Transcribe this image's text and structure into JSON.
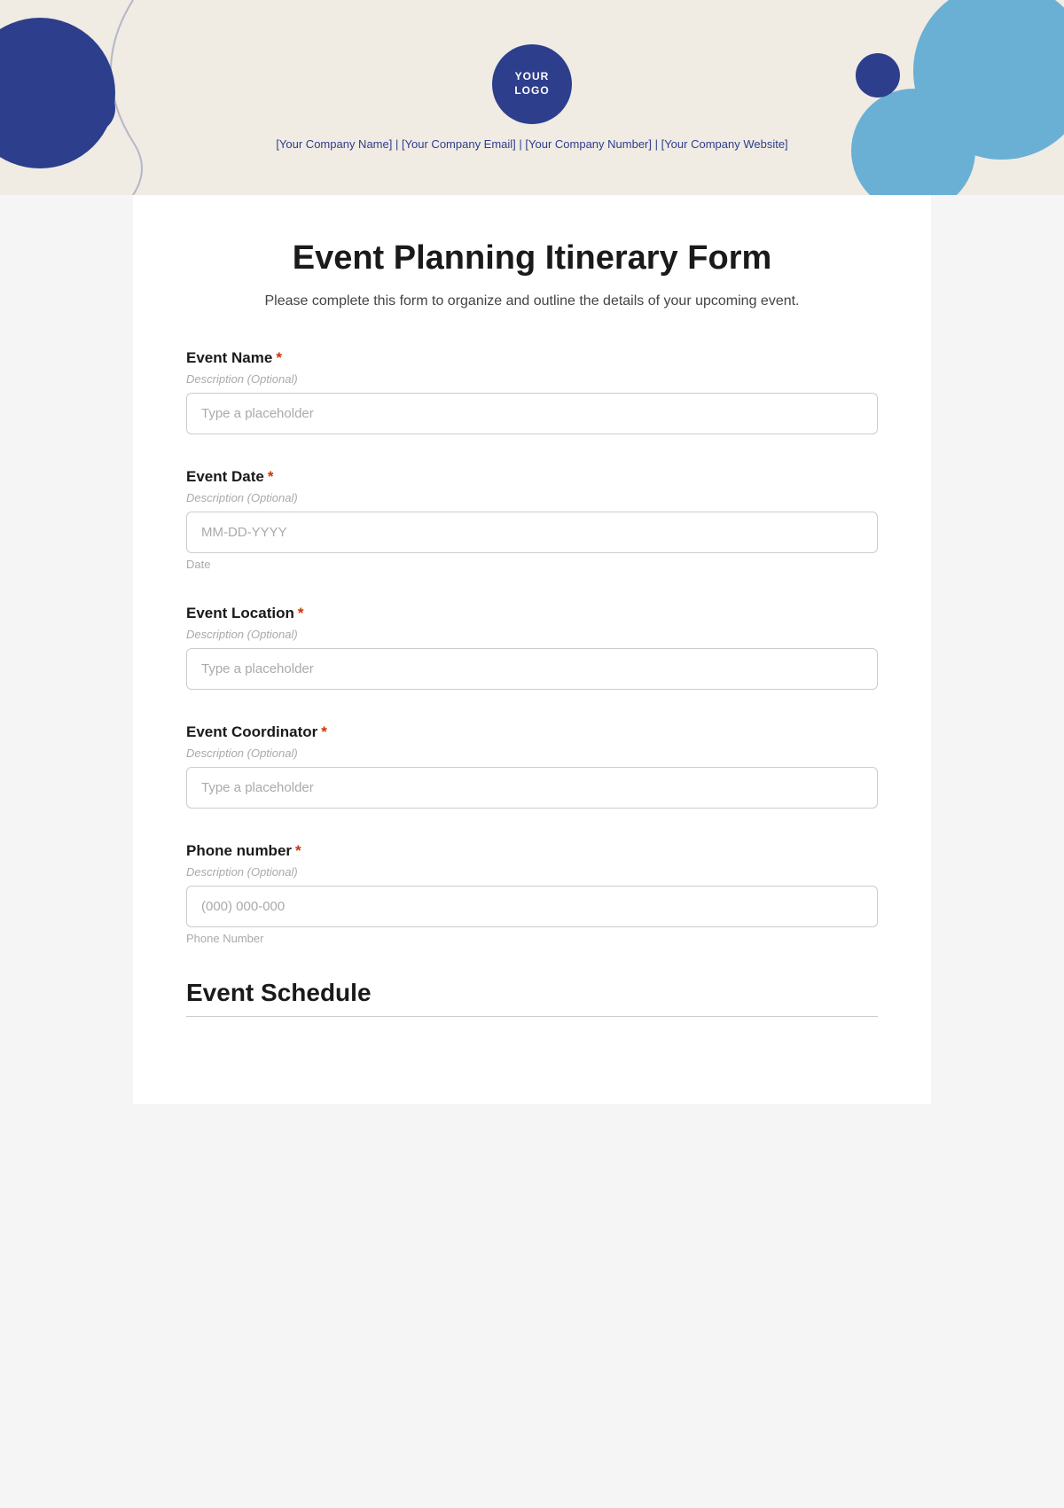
{
  "header": {
    "logo_text": "YOUR\nLOGO",
    "company_info": "[Your Company Name]  |  [Your Company Email]  |  [Your Company Number]  |  [Your Company Website]"
  },
  "form": {
    "title": "Event Planning Itinerary Form",
    "subtitle": "Please complete this form to organize and outline the details of your upcoming event.",
    "fields": [
      {
        "id": "event-name",
        "label": "Event Name",
        "required": true,
        "description": "Description (Optional)",
        "placeholder": "Type a placeholder",
        "type": "text",
        "hint": ""
      },
      {
        "id": "event-date",
        "label": "Event Date",
        "required": true,
        "description": "Description (Optional)",
        "placeholder": "MM-DD-YYYY",
        "type": "text",
        "hint": "Date"
      },
      {
        "id": "event-location",
        "label": "Event Location",
        "required": true,
        "description": "Description (Optional)",
        "placeholder": "Type a placeholder",
        "type": "text",
        "hint": ""
      },
      {
        "id": "event-coordinator",
        "label": "Event Coordinator",
        "required": true,
        "description": "Description (Optional)",
        "placeholder": "Type a placeholder",
        "type": "text",
        "hint": ""
      },
      {
        "id": "phone-number",
        "label": "Phone number",
        "required": true,
        "description": "Description (Optional)",
        "placeholder": "(000) 000-000",
        "type": "text",
        "hint": "Phone Number"
      }
    ],
    "section_event_schedule": {
      "title": "Event Schedule"
    }
  }
}
